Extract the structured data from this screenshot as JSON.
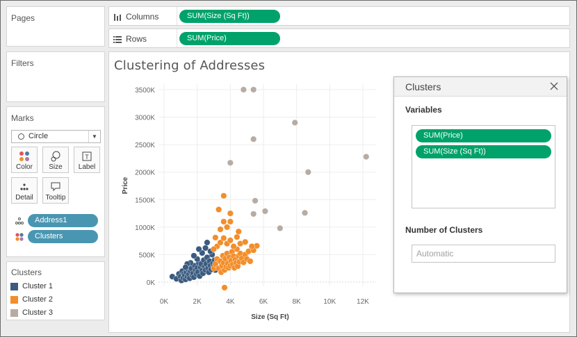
{
  "sidebar": {
    "pages_title": "Pages",
    "filters_title": "Filters",
    "marks": {
      "title": "Marks",
      "mark_type": "Circle",
      "buttons": [
        {
          "label": "Color",
          "icon": "color-icon"
        },
        {
          "label": "Size",
          "icon": "size-icon"
        },
        {
          "label": "Label",
          "icon": "label-icon"
        },
        {
          "label": "Detail",
          "icon": "detail-icon"
        },
        {
          "label": "Tooltip",
          "icon": "tooltip-icon"
        }
      ],
      "fields": [
        {
          "label": "Address1",
          "icon": "detail-icon"
        },
        {
          "label": "Clusters",
          "icon": "color-icon"
        }
      ]
    },
    "legend": {
      "title": "Clusters",
      "items": [
        {
          "label": "Cluster 1",
          "color": "#3b5b80"
        },
        {
          "label": "Cluster 2",
          "color": "#f28e2b"
        },
        {
          "label": "Cluster 3",
          "color": "#b7aba3"
        }
      ]
    }
  },
  "shelves": {
    "columns": {
      "label": "Columns",
      "pill": "SUM(Size (Sq Ft))"
    },
    "rows": {
      "label": "Rows",
      "pill": "SUM(Price)"
    }
  },
  "view": {
    "title": "Clustering of Addresses"
  },
  "chart_data": {
    "type": "scatter",
    "title": "Clustering of Addresses",
    "xlabel": "Size (Sq Ft)",
    "ylabel": "Price",
    "xlim": [
      0,
      12800
    ],
    "ylim": [
      0,
      3500000
    ],
    "xticks": [
      "0K",
      "2K",
      "4K",
      "6K",
      "8K",
      "10K",
      "12K"
    ],
    "yticks": [
      "0K",
      "500K",
      "1000K",
      "1500K",
      "2000K",
      "2500K",
      "3000K",
      "3500K"
    ],
    "grid": true,
    "series": [
      {
        "name": "Cluster 1",
        "color": "#3b5b80",
        "points": [
          [
            500,
            100000
          ],
          [
            750,
            60000
          ],
          [
            900,
            150000
          ],
          [
            1000,
            100000
          ],
          [
            1050,
            30000
          ],
          [
            1100,
            200000
          ],
          [
            1150,
            80000
          ],
          [
            1200,
            150000
          ],
          [
            1250,
            120000
          ],
          [
            1300,
            50000
          ],
          [
            1350,
            180000
          ],
          [
            1400,
            100000
          ],
          [
            1450,
            230000
          ],
          [
            1500,
            140000
          ],
          [
            1550,
            70000
          ],
          [
            1600,
            200000
          ],
          [
            1650,
            250000
          ],
          [
            1700,
            120000
          ],
          [
            1750,
            160000
          ],
          [
            1800,
            90000
          ],
          [
            1850,
            300000
          ],
          [
            1900,
            220000
          ],
          [
            1950,
            150000
          ],
          [
            2000,
            260000
          ],
          [
            2050,
            180000
          ],
          [
            2100,
            350000
          ],
          [
            2150,
            110000
          ],
          [
            2200,
            270000
          ],
          [
            2250,
            330000
          ],
          [
            2300,
            210000
          ],
          [
            2350,
            160000
          ],
          [
            2400,
            400000
          ],
          [
            2450,
            280000
          ],
          [
            2500,
            220000
          ],
          [
            2550,
            330000
          ],
          [
            2600,
            450000
          ],
          [
            2650,
            250000
          ],
          [
            2700,
            180000
          ],
          [
            2750,
            380000
          ],
          [
            2800,
            300000
          ],
          [
            2850,
            230000
          ],
          [
            2900,
            500000
          ],
          [
            2950,
            340000
          ],
          [
            3000,
            280000
          ],
          [
            3050,
            400000
          ],
          [
            3100,
            220000
          ],
          [
            1600,
            350000
          ],
          [
            2000,
            420000
          ],
          [
            2300,
            530000
          ],
          [
            2500,
            620000
          ],
          [
            2600,
            720000
          ],
          [
            2100,
            600000
          ],
          [
            2800,
            560000
          ],
          [
            1800,
            480000
          ],
          [
            1400,
            330000
          ],
          [
            1300,
            270000
          ]
        ]
      },
      {
        "name": "Cluster 2",
        "color": "#f28e2b",
        "points": [
          [
            3000,
            250000
          ],
          [
            3100,
            330000
          ],
          [
            3200,
            420000
          ],
          [
            3300,
            250000
          ],
          [
            3400,
            380000
          ],
          [
            3450,
            180000
          ],
          [
            3500,
            300000
          ],
          [
            3550,
            480000
          ],
          [
            3600,
            350000
          ],
          [
            3650,
            220000
          ],
          [
            3700,
            430000
          ],
          [
            3750,
            280000
          ],
          [
            3800,
            520000
          ],
          [
            3850,
            340000
          ],
          [
            3900,
            260000
          ],
          [
            3950,
            450000
          ],
          [
            4000,
            300000
          ],
          [
            4050,
            390000
          ],
          [
            4100,
            550000
          ],
          [
            4150,
            320000
          ],
          [
            4200,
            470000
          ],
          [
            4250,
            260000
          ],
          [
            4300,
            410000
          ],
          [
            4350,
            350000
          ],
          [
            4400,
            600000
          ],
          [
            4450,
            290000
          ],
          [
            4500,
            480000
          ],
          [
            4550,
            370000
          ],
          [
            4600,
            520000
          ],
          [
            4700,
            430000
          ],
          [
            4800,
            360000
          ],
          [
            4900,
            500000
          ],
          [
            5000,
            420000
          ],
          [
            5100,
            560000
          ],
          [
            5200,
            380000
          ],
          [
            5400,
            580000
          ],
          [
            5600,
            660000
          ],
          [
            3200,
            650000
          ],
          [
            3400,
            720000
          ],
          [
            3600,
            800000
          ],
          [
            3800,
            700000
          ],
          [
            4000,
            760000
          ],
          [
            4200,
            650000
          ],
          [
            4400,
            820000
          ],
          [
            4600,
            700000
          ],
          [
            4900,
            730000
          ],
          [
            5300,
            650000
          ],
          [
            3000,
            600000
          ],
          [
            3400,
            960000
          ],
          [
            3600,
            1100000
          ],
          [
            4000,
            1250000
          ],
          [
            4000,
            1100000
          ],
          [
            3100,
            810000
          ],
          [
            3800,
            1000000
          ],
          [
            3300,
            1320000
          ],
          [
            4500,
            920000
          ],
          [
            3600,
            1570000
          ],
          [
            3650,
            -100000
          ]
        ]
      },
      {
        "name": "Cluster 3",
        "color": "#b7aba3",
        "points": [
          [
            4800,
            3500000
          ],
          [
            5400,
            3500000
          ],
          [
            7900,
            2900000
          ],
          [
            5400,
            2600000
          ],
          [
            4000,
            2170000
          ],
          [
            8700,
            2000000
          ],
          [
            12200,
            2280000
          ],
          [
            5500,
            1480000
          ],
          [
            6100,
            1290000
          ],
          [
            5400,
            1240000
          ],
          [
            8500,
            1260000
          ],
          [
            7000,
            980000
          ]
        ]
      }
    ]
  },
  "dialog": {
    "title": "Clusters",
    "variables_label": "Variables",
    "variables": [
      "SUM(Price)",
      "SUM(Size (Sq Ft))"
    ],
    "num_clusters_label": "Number of Clusters",
    "num_clusters_placeholder": "Automatic",
    "num_clusters_value": ""
  }
}
